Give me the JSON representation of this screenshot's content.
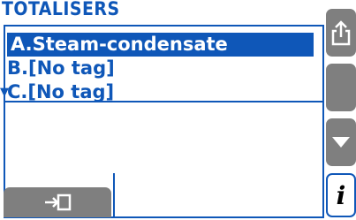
{
  "screen": {
    "title": "TOTALISERS"
  },
  "list": {
    "items": [
      {
        "label": "A.Steam-condensate",
        "selected": true
      },
      {
        "label": "B.[No tag]",
        "selected": false
      },
      {
        "label": "C.[No tag]",
        "selected": false
      }
    ]
  },
  "side_buttons": {
    "share": {
      "icon": "share-icon"
    },
    "blank": {
      "icon": ""
    },
    "down": {
      "icon": "triangle-down-icon"
    },
    "info": {
      "icon": "info-icon",
      "label": "i"
    }
  },
  "bottom_button": {
    "icon": "enter-icon"
  },
  "colors": {
    "accent": "#0f57b8",
    "button_gray": "#7f7f7f",
    "background": "#ffffff"
  }
}
